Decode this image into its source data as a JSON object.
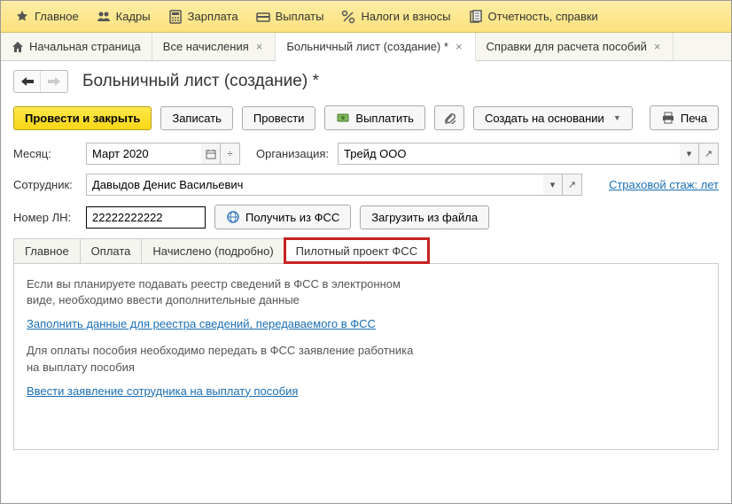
{
  "top_menu": {
    "items": [
      {
        "label": "Главное"
      },
      {
        "label": "Кадры"
      },
      {
        "label": "Зарплата"
      },
      {
        "label": "Выплаты"
      },
      {
        "label": "Налоги и взносы"
      },
      {
        "label": "Отчетность, справки"
      }
    ]
  },
  "tabs": {
    "items": [
      {
        "label": "Начальная страница",
        "closable": false,
        "home": true
      },
      {
        "label": "Все начисления",
        "closable": true
      },
      {
        "label": "Больничный лист (создание) *",
        "closable": true,
        "active": true
      },
      {
        "label": "Справки для расчета пособий",
        "closable": true
      }
    ]
  },
  "page_title": "Больничный лист (создание) *",
  "toolbar": {
    "post_close": "Провести и закрыть",
    "save": "Записать",
    "post": "Провести",
    "pay": "Выплатить",
    "create_based": "Создать на основании",
    "print": "Печа"
  },
  "form": {
    "month_label": "Месяц:",
    "month_value": "Март 2020",
    "org_label": "Организация:",
    "org_value": "Трейд ООО",
    "emp_label": "Сотрудник:",
    "emp_value": "Давыдов Денис Васильевич",
    "insurance_link": "Страховой стаж: лет",
    "ln_label": "Номер ЛН:",
    "ln_value": "22222222222",
    "get_fss": "Получить из ФСС",
    "load_file": "Загрузить из файла"
  },
  "inner_tabs": {
    "items": [
      "Главное",
      "Оплата",
      "Начислено (подробно)",
      "Пилотный проект ФСС"
    ],
    "active": 3
  },
  "panel": {
    "text1": "Если вы планируете подавать реестр сведений в ФСС в электронном виде, необходимо ввести дополнительные данные",
    "link1": "Заполнить данные для реестра сведений, передаваемого в ФСС",
    "text2": "Для оплаты пособия необходимо передать в ФСС заявление работника на выплату пособия",
    "link2": "Ввести заявление сотрудника на выплату пособия"
  }
}
